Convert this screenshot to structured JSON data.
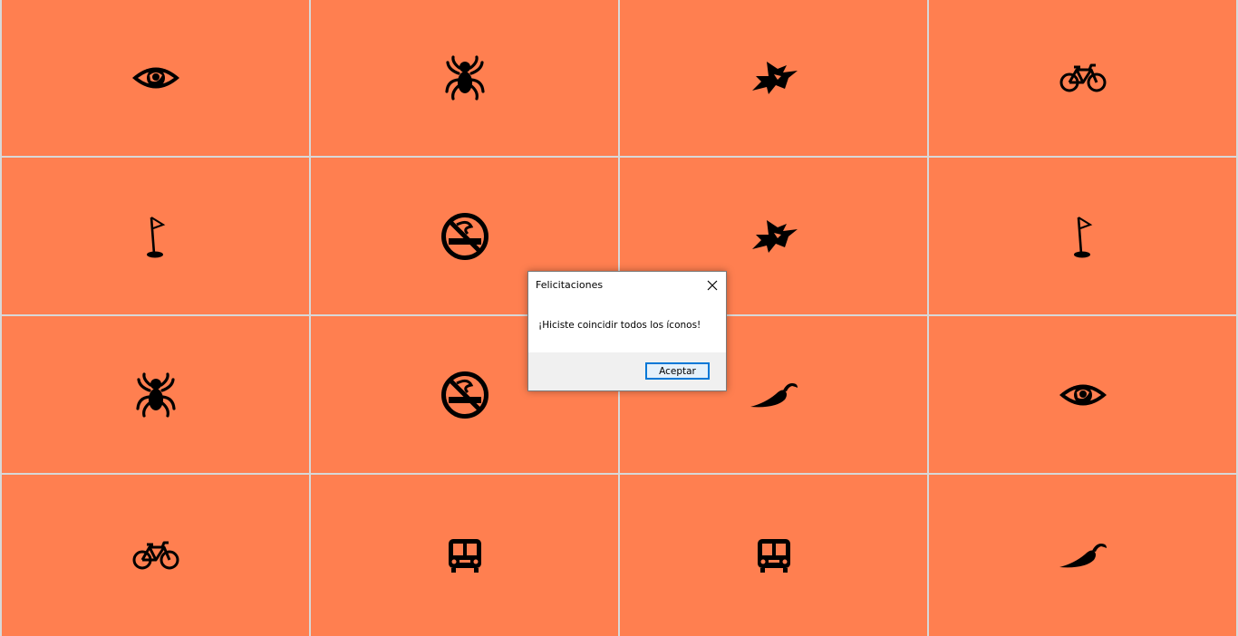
{
  "colors": {
    "tile": "#ff7f50",
    "grid_line": "#d8d8d8",
    "icon": "#000000",
    "dialog_footer": "#f0f0f0",
    "button_border": "#0078d7"
  },
  "grid": {
    "columns": 4,
    "rows": 4,
    "tiles": [
      "eye-icon",
      "spider-icon",
      "ninja-icon",
      "bicycle-icon",
      "golf-flag-icon",
      "no-smoking-icon",
      "ninja-icon",
      "golf-flag-icon",
      "spider-icon",
      "no-smoking-icon",
      "chili-pepper-icon",
      "eye-icon",
      "bicycle-icon",
      "train-icon",
      "train-icon",
      "chili-pepper-icon"
    ]
  },
  "dialog": {
    "title": "Felicitaciones",
    "message": "¡Hiciste coincidir todos los íconos!",
    "ok_label": "Aceptar",
    "close_icon": "close-icon"
  }
}
